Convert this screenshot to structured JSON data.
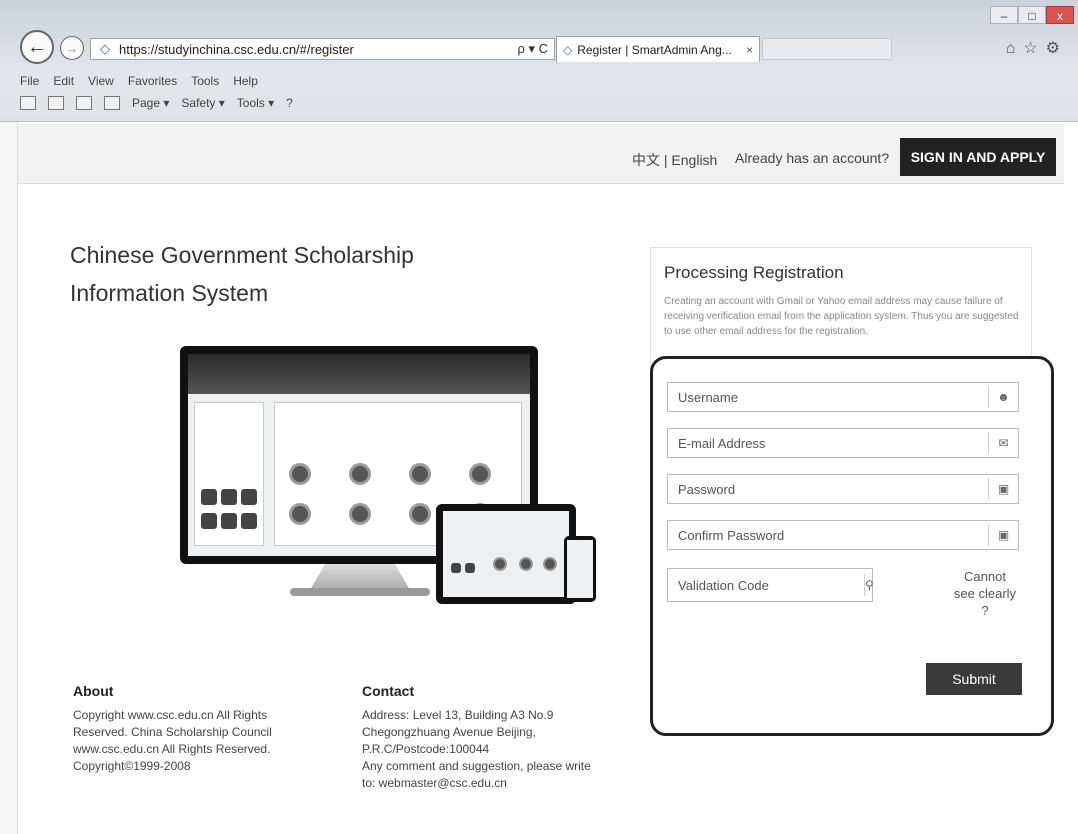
{
  "browser": {
    "url": "https://studyinchina.csc.edu.cn/#/register",
    "address_controls": "ρ ▾ C",
    "tab_title": "Register | SmartAdmin Ang...",
    "tab_close": "×",
    "menu": [
      "File",
      "Edit",
      "View",
      "Favorites",
      "Tools",
      "Help"
    ],
    "command_bar": [
      "Page ▾",
      "Safety ▾",
      "Tools ▾"
    ]
  },
  "topbar": {
    "lang_zh": "中文",
    "lang_sep": " | ",
    "lang_en": "English",
    "have_account": "Already has an account?",
    "signin_label": "SIGN IN AND APPLY"
  },
  "hero": {
    "title": "Chinese Government Scholarship Information System"
  },
  "registration": {
    "title": "Processing Registration",
    "note": "Creating an account with Gmail or Yahoo email address may cause failure of receiving verification email from the application system. Thus you are suggested to use other email address for the registration.",
    "username_placeholder": "Username",
    "email_placeholder": "E-mail Address",
    "password_placeholder": "Password",
    "confirm_placeholder": "Confirm Password",
    "code_placeholder": "Validation Code",
    "cannot_see": "Cannot see clearly ?",
    "submit_label": "Submit"
  },
  "footer": {
    "about_title": "About",
    "about_lines": [
      "Copyright www.csc.edu.cn All Rights",
      "Reserved. China Scholarship Council",
      "www.csc.edu.cn All Rights Reserved.",
      "Copyright©1999-2008"
    ],
    "contact_title": "Contact",
    "contact_lines": [
      "Address: Level 13, Building A3 No.9",
      "Chegongzhuang Avenue Beijing,",
      "P.R.C/Postcode:100044",
      "Any comment and suggestion, please write",
      "to: webmaster@csc.edu.cn"
    ]
  },
  "icons": {
    "user": "user-icon",
    "email": "envelope-icon",
    "password": "lock-icon",
    "confirm": "lock-icon",
    "code": "key-icon"
  }
}
